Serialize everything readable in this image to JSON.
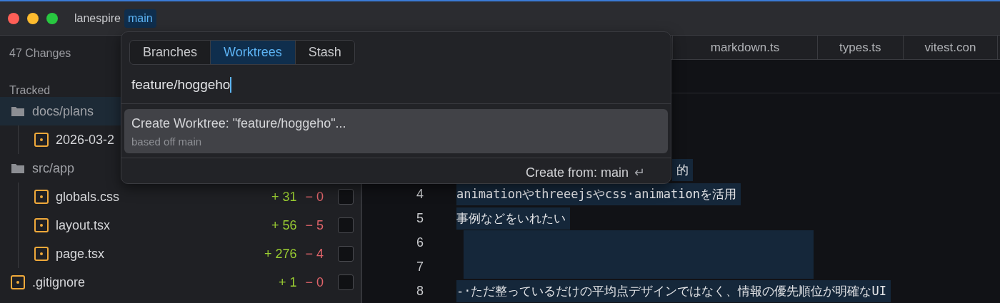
{
  "window": {
    "title": "lanespire",
    "branch": "main"
  },
  "sidebar": {
    "header": "47 Changes",
    "section": "Tracked",
    "items": [
      {
        "kind": "folder",
        "name": "docs/plans",
        "selected": true,
        "children": [
          {
            "kind": "file",
            "name": "2026-03-2",
            "selected": false
          }
        ]
      },
      {
        "kind": "folder",
        "name": "src/app",
        "selected": false,
        "children": [
          {
            "kind": "file",
            "name": "globals.css",
            "added": "+ 31",
            "removed": "− 0",
            "checked": false,
            "selected": false
          },
          {
            "kind": "file",
            "name": "layout.tsx",
            "added": "+ 56",
            "removed": "− 5",
            "checked": false,
            "selected": false
          },
          {
            "kind": "file",
            "name": "page.tsx",
            "added": "+ 276",
            "removed": "− 4",
            "checked": false,
            "selected": false
          }
        ]
      },
      {
        "kind": "file",
        "name": ".gitignore",
        "added": "+ 1",
        "removed": "− 0",
        "checked": false,
        "selected": false
      }
    ]
  },
  "editor": {
    "tabs": [
      {
        "label": "markdown.ts"
      },
      {
        "label": "types.ts"
      },
      {
        "label": "vitest.con"
      }
    ],
    "lines": [
      {
        "text": "的",
        "selected": true
      },
      {
        "number": "4",
        "text": "animationやthreeejsやcss·animationを活用",
        "selected": true
      },
      {
        "number": "5",
        "text": "事例などをいれたい",
        "selected": true
      },
      {
        "number": "6",
        "selected": true
      },
      {
        "number": "7",
        "selected": true
      },
      {
        "number": "8",
        "text": "-·ただ整っているだけの平均点デザインではなく、情報の優先順位が明確なUI",
        "selected": true
      }
    ]
  },
  "popup": {
    "tabs": [
      {
        "label": "Branches",
        "selected": false
      },
      {
        "label": "Worktrees",
        "selected": true
      },
      {
        "label": "Stash",
        "selected": false
      }
    ],
    "input": {
      "value": "feature/hoggeho"
    },
    "results": [
      {
        "title": "Create Worktree: \"feature/hoggeho\"...",
        "subtitle": "based off main",
        "selected": true
      }
    ],
    "footer": "Create from: main",
    "enter_glyph": "↵"
  }
}
